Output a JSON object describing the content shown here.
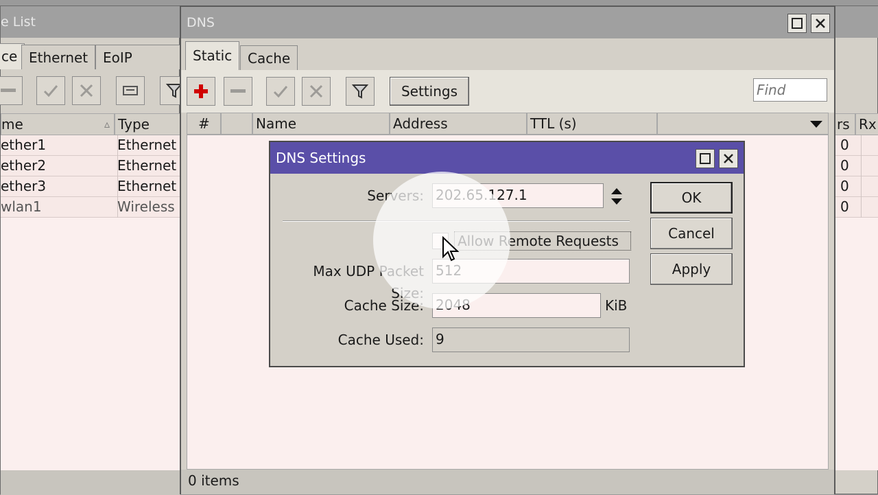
{
  "interface_window": {
    "title": "e List",
    "tabs": [
      "ce",
      "Ethernet",
      "EoIP Tunne"
    ],
    "columns": [
      "me",
      "Type"
    ],
    "rows": [
      {
        "name": "ether1",
        "type": "Ethernet"
      },
      {
        "name": "ether2",
        "type": "Ethernet"
      },
      {
        "name": "ether3",
        "type": "Ethernet"
      },
      {
        "name": "wlan1",
        "type": "Wireless ("
      }
    ]
  },
  "dns_window": {
    "title": "DNS",
    "tabs": [
      "Static",
      "Cache"
    ],
    "settings_label": "Settings",
    "find_placeholder": "Find",
    "columns": [
      "#",
      "",
      "Name",
      "Address",
      "TTL (s)"
    ],
    "status": "0 items"
  },
  "right_window": {
    "columns": [
      "rs",
      "Rx"
    ],
    "values": [
      "0",
      "0",
      "0",
      "0"
    ]
  },
  "dns_settings": {
    "title": "DNS Settings",
    "servers_label": "Servers:",
    "servers_value": "202.65.127.1",
    "allow_remote_label": "Allow Remote Requests",
    "allow_remote_checked": false,
    "max_udp_label": "Max UDP Packet Size:",
    "max_udp_value": "512",
    "cache_size_label": "Cache Size:",
    "cache_size_value": "2048",
    "cache_size_unit": "KiB",
    "cache_used_label": "Cache Used:",
    "cache_used_value": "9",
    "ok_label": "OK",
    "cancel_label": "Cancel",
    "apply_label": "Apply"
  },
  "colors": {
    "dialog_title": "#5a4fa8",
    "list_background": "#fbefee",
    "add_icon": "#d00000"
  }
}
